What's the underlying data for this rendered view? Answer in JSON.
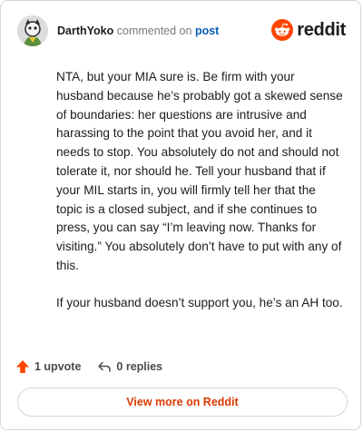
{
  "comment": {
    "username": "DarthYoko",
    "action": "commented on",
    "post_link": "post",
    "paragraphs": [
      "NTA, but your MIA sure is. Be firm with your husband because he’s probably got a skewed sense of boundaries: her questions are intrusive and harassing to the point that you avoid her, and it needs to stop. You absolutely do not and should not tolerate it, nor should he. Tell your husband that if your MIL starts in, you will firmly tell her that the topic is a closed subject, and if she continues to press, you can say “I’m leaving now. Thanks for visiting.” You absolutely don’t have to put with any of this.",
      "If your husband doesn’t support you, he’s an AH too."
    ],
    "upvotes": "1 upvote",
    "replies": "0 replies"
  },
  "brand": {
    "wordmark": "reddit",
    "logo_icon": "reddit-snoo-icon",
    "color": "#ff4500"
  },
  "actions": {
    "view_more": "View more on Reddit"
  },
  "colors": {
    "link": "#0a5ab8",
    "upvote": "#ff4500",
    "view_more_text": "#d93a00"
  }
}
